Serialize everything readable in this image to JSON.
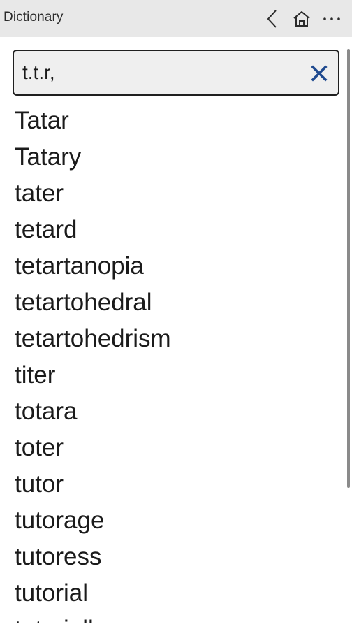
{
  "app": {
    "title": "Dictionary"
  },
  "toolbar": {
    "back_icon": "chevron-left-icon",
    "home_icon": "home-icon",
    "more_icon": "more-horizontal-icon"
  },
  "search": {
    "value": "t.t.r,",
    "clear_icon": "close-icon",
    "clear_color": "#1f4a8f"
  },
  "results": [
    "Tatar",
    "Tatary",
    "tater",
    "tetard",
    "tetartanopia",
    "tetartohedral",
    "tetartohedrism",
    "titer",
    "totara",
    "toter",
    "tutor",
    "tutorage",
    "tutoress",
    "tutorial",
    "tutorially"
  ]
}
